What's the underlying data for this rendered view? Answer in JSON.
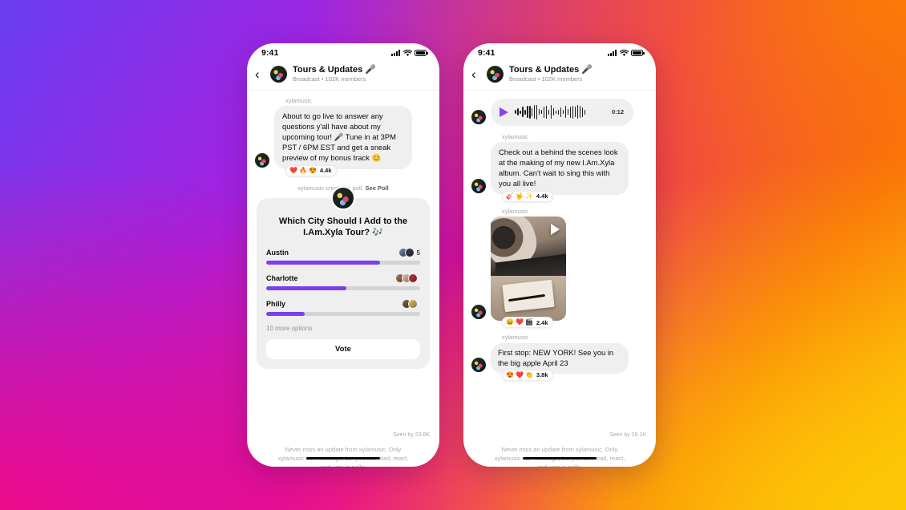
{
  "theme": {
    "gradient_start": "#6a3ef0",
    "gradient_mid_purple": "#a321e0",
    "gradient_magenta": "#ee0a8a",
    "gradient_orange": "#fb7a07",
    "gradient_yellow": "#fdc706",
    "accent_purple": "#7b3ff2",
    "bubble_gray": "#efefef"
  },
  "status_bar": {
    "time": "9:41",
    "signal_icon": "signal-bars-icon",
    "wifi_icon": "wifi-icon",
    "battery_icon": "battery-icon"
  },
  "header": {
    "back_icon": "back-chevron-icon",
    "avatar": "channel-avatar",
    "title": "Tours & Updates",
    "title_emoji": "🎤",
    "subtitle": "Broadcast • 102K members"
  },
  "disclaimer": "Never miss an update from xylamusic. Only xylamusic can message, but you can read, react, and vote in polls.",
  "phone_left": {
    "messages": [
      {
        "sender": "xylamusic",
        "text": "About to go live to answer any questions y'all have about my upcoming tour! 🎤 Tune in at 3PM PST / 6PM EST and get a sneak preview of my bonus track 😊",
        "reactions": [
          "❤️",
          "🔥",
          "😍"
        ],
        "reaction_count": "4.4k"
      }
    ],
    "poll_note_text": "xylamusic created a poll.",
    "poll_note_link": "See Poll",
    "poll": {
      "title": "Which City Should I Add to the I.Am.Xyla Tour? 🎶",
      "options": [
        {
          "label": "Austin",
          "percent": 74,
          "count": "5",
          "voters": 2
        },
        {
          "label": "Charlotte",
          "percent": 52,
          "count": "",
          "voters": 3
        },
        {
          "label": "Philly",
          "percent": 25,
          "count": "",
          "voters": 2
        }
      ],
      "more_options": "10 more options",
      "vote_button": "Vote"
    },
    "seen_by": "Seen by 23.8K"
  },
  "phone_right": {
    "audio": {
      "play_icon": "play-icon",
      "duration": "0:12"
    },
    "messages": [
      {
        "sender": "xylamusic",
        "text": "Check out a behind the scenes look at the making of my new I.Am.Xyla album. Can't wait to sing this with you all live!",
        "reactions": [
          "🎸",
          "🤟",
          "✨"
        ],
        "reaction_count": "4.4k"
      },
      {
        "sender": "xylamusic",
        "type": "video",
        "play_icon": "video-play-icon",
        "reactions": [
          "😄",
          "❤️",
          "🎬"
        ],
        "reaction_count": "2.4k"
      },
      {
        "sender": "xylamusic",
        "text": "First stop: NEW YORK! See you in the big apple April 23",
        "reactions": [
          "😍",
          "❤️",
          "👏"
        ],
        "reaction_count": "3.8k"
      }
    ],
    "seen_by": "Seen by 28.1K"
  }
}
